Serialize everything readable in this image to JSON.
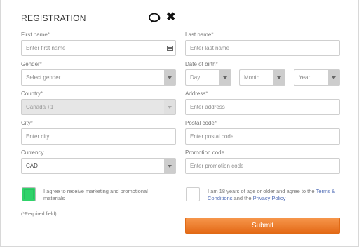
{
  "header": {
    "title": "REGISTRATION"
  },
  "form": {
    "first_name": {
      "label": "First name",
      "placeholder": "Enter first name"
    },
    "last_name": {
      "label": "Last name",
      "placeholder": "Enter last name"
    },
    "gender": {
      "label": "Gender",
      "value": "Select gender.."
    },
    "dob": {
      "label": "Date of birth",
      "day": "Day",
      "month": "Month",
      "year": "Year"
    },
    "country": {
      "label": "Country",
      "value": "Canada +1"
    },
    "address": {
      "label": "Address",
      "placeholder": "Enter address"
    },
    "city": {
      "label": "City",
      "placeholder": "Enter city"
    },
    "postal": {
      "label": "Postal code",
      "placeholder": "Enter postal code"
    },
    "currency": {
      "label": "Currency",
      "value": "CAD"
    },
    "promo": {
      "label": "Promotion code",
      "placeholder": "Enter promotion code"
    },
    "required_mark": "*",
    "marketing": {
      "text": "I agree to receive marketing and promotional materials",
      "checked": true
    },
    "age": {
      "text_before": "I am 18 years of age or older and agree to the",
      "terms_link": "Terms & Conditions",
      "and": "and the",
      "privacy_link": "Privacy Policy",
      "checked": false
    },
    "required_note": "(*Required field)",
    "submit_label": "Submit"
  },
  "colors": {
    "accent": "#e97a2a",
    "checkbox_checked": "#2fd36a",
    "link": "#5470b8"
  }
}
